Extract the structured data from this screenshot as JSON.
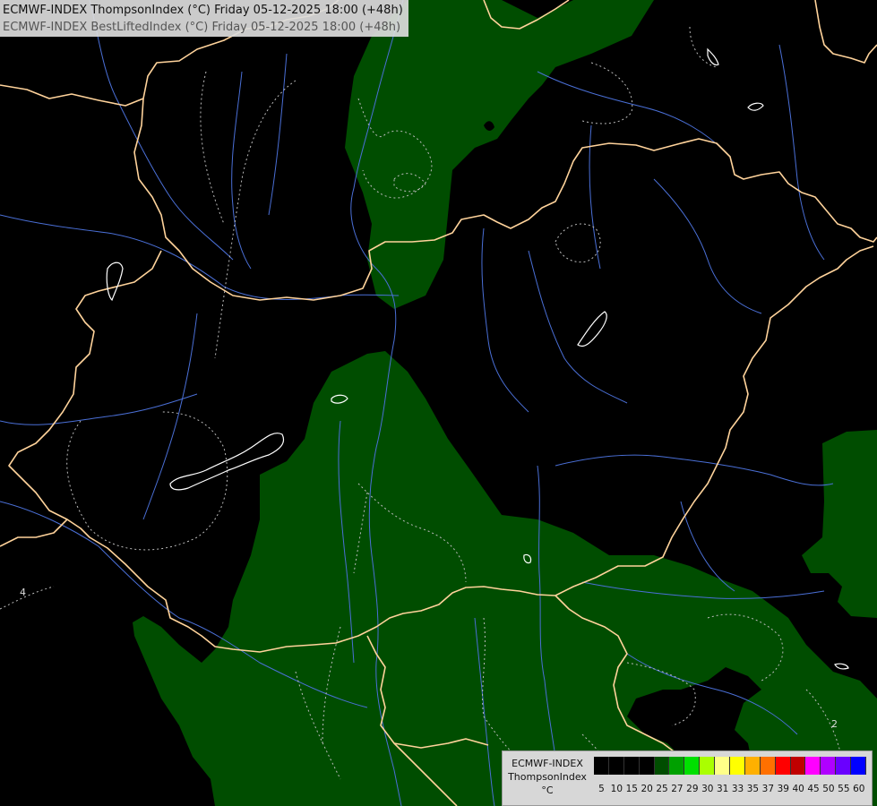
{
  "header": {
    "line1": "ECMWF-INDEX ThompsonIndex (°C) Friday 05-12-2025 18:00 (+48h)",
    "line2": "ECMWF-INDEX BestLiftedIndex (°C) Friday 05-12-2025 18:00 (+48h)"
  },
  "legend": {
    "title": "ECMWF-INDEX",
    "variable": "ThompsonIndex",
    "unit": "°C",
    "ticks": [
      "5",
      "10",
      "15",
      "20",
      "25",
      "27",
      "29",
      "30",
      "31",
      "33",
      "35",
      "37",
      "39",
      "40",
      "45",
      "50",
      "55",
      "60"
    ],
    "colors": [
      "#000000",
      "#000000",
      "#000000",
      "#000000",
      "#004d00",
      "#00a000",
      "#00e000",
      "#aaff00",
      "#ffff88",
      "#ffff00",
      "#ffb000",
      "#ff7000",
      "#ff0000",
      "#c00000",
      "#ff00ff",
      "#b000ff",
      "#6a00ff",
      "#0000ff"
    ]
  },
  "map": {
    "background_color": "#000000",
    "fill_color": "#004d00",
    "border_color": "#ffd39b",
    "river_color": "#4a6fd6",
    "contour_labels": [
      "4",
      "2"
    ]
  }
}
